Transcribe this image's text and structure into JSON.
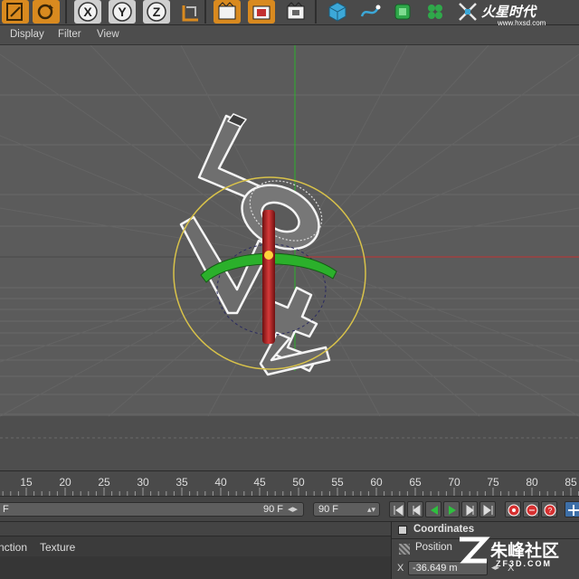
{
  "menu": {
    "display": "Display",
    "filter": "Filter",
    "view": "View"
  },
  "toolbar": {
    "tools": [
      "scale-tool-icon",
      "rotate-tool-icon",
      "x-axis-lock",
      "y-axis-lock",
      "z-axis-lock",
      "world-coordinate-icon",
      "render-view-icon",
      "render-picture-queue-icon",
      "render-settings-icon",
      "cube-primitive-icon",
      "spline-pen-icon",
      "subdivision-surface-icon",
      "cloner-icon",
      "deformer-icon"
    ],
    "x_label": "X",
    "y_label": "Y",
    "z_label": "Z"
  },
  "watermark_top": {
    "brand": "火星时代",
    "url": "www.hxsd.com"
  },
  "timeline": {
    "ticks": [
      "15",
      "20",
      "25",
      "30",
      "35",
      "40",
      "45",
      "50",
      "55",
      "60",
      "65",
      "70",
      "75",
      "80",
      "85"
    ],
    "current_frame": 50
  },
  "transport": {
    "range_start_suffix": "F",
    "range_end": "90 F",
    "max_frame": "90 F"
  },
  "tabs_left": {
    "tab1": "Function",
    "tab2": "Texture"
  },
  "coordinates": {
    "title": "Coordinates",
    "position_tab": "Position",
    "x_label": "X",
    "x_value": "-36.649 m",
    "x_right_label": "X"
  },
  "watermark_bottom": {
    "brand": "朱峰社区",
    "url": "ZF3D.COM"
  },
  "colors": {
    "viewport_bg": "#5b5b5b",
    "x_axis": "#c33030",
    "y_axis": "#2bb02b",
    "selection_circle": "#d8c24a"
  }
}
